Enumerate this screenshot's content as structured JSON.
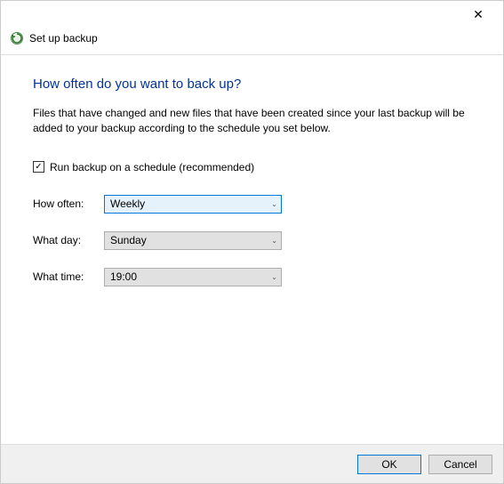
{
  "window": {
    "title": "Set up backup"
  },
  "main": {
    "heading": "How often do you want to back up?",
    "intro": "Files that have changed and new files that have been created since your last backup will be added to your backup according to the schedule you set below."
  },
  "checkbox": {
    "checked": true,
    "label": "Run backup on a schedule (recommended)"
  },
  "fields": {
    "how_often": {
      "label": "How often:",
      "value": "Weekly"
    },
    "what_day": {
      "label": "What day:",
      "value": "Sunday"
    },
    "what_time": {
      "label": "What time:",
      "value": "19:00"
    }
  },
  "buttons": {
    "ok": "OK",
    "cancel": "Cancel"
  },
  "icons": {
    "close": "✕",
    "check": "✓",
    "chevron": "⌄"
  }
}
